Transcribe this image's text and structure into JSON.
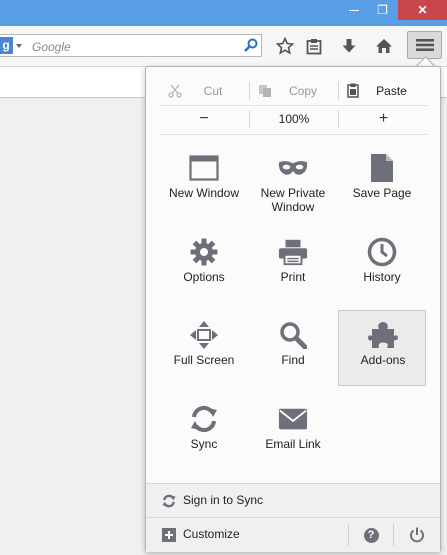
{
  "window": {
    "minimize_glyph": "—",
    "maximize_glyph": "❐",
    "close_glyph": "✕"
  },
  "search": {
    "engine_letter": "g",
    "placeholder": "Google"
  },
  "toolbar": {
    "icons": [
      "star-icon",
      "clipboard-icon",
      "download-icon",
      "home-icon",
      "menu-icon"
    ]
  },
  "menu": {
    "edit": {
      "cut": "Cut",
      "copy": "Copy",
      "paste": "Paste"
    },
    "zoom": {
      "out": "−",
      "level": "100%",
      "in": "+"
    },
    "items": [
      {
        "label": "New Window",
        "icon": "new-window-icon"
      },
      {
        "label": "New Private Window",
        "icon": "private-mask-icon"
      },
      {
        "label": "Save Page",
        "icon": "save-page-icon"
      },
      {
        "label": "Options",
        "icon": "gear-icon"
      },
      {
        "label": "Print",
        "icon": "printer-icon"
      },
      {
        "label": "History",
        "icon": "clock-icon"
      },
      {
        "label": "Full Screen",
        "icon": "fullscreen-icon"
      },
      {
        "label": "Find",
        "icon": "magnifier-icon"
      },
      {
        "label": "Add-ons",
        "icon": "puzzle-icon"
      },
      {
        "label": "Sync",
        "icon": "sync-icon"
      },
      {
        "label": "Email Link",
        "icon": "envelope-icon"
      }
    ],
    "footer": {
      "sign_in": "Sign in to Sync",
      "customize": "Customize",
      "help_glyph": "?"
    }
  },
  "colors": {
    "titlebar": "#5a9ee6",
    "close": "#c8474a",
    "icon_gray": "#6d7078",
    "addons_bg": "#ebebeb"
  }
}
